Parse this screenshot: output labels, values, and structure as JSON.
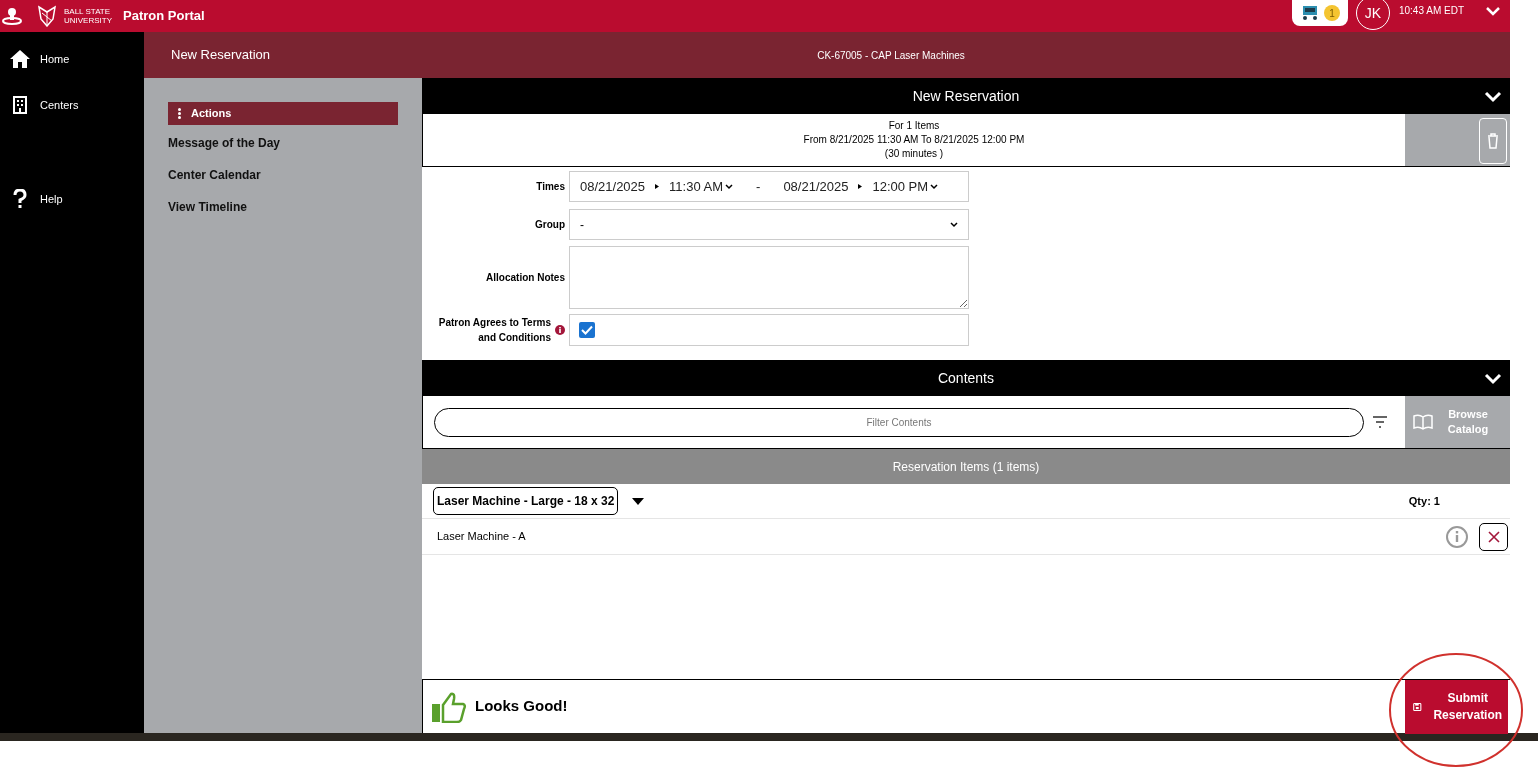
{
  "top_bar": {
    "university": "BALL STATE UNIVERSITY",
    "title": "Patron Portal",
    "cart_count": "1",
    "user_initials": "JK",
    "time": "10:43 AM EDT"
  },
  "nav": [
    {
      "kind": "home",
      "label": "Home"
    },
    {
      "kind": "building",
      "label": "Centers"
    },
    {
      "kind": "help",
      "label": "Help"
    }
  ],
  "page_header": {
    "title": "New Reservation",
    "center": "CK-67005 - CAP Laser Machines"
  },
  "actions": {
    "title": "Actions",
    "items": [
      "Message of the Day",
      "Center Calendar",
      "View Timeline"
    ]
  },
  "reservation": {
    "title": "New Reservation",
    "summary": [
      "For 1 Items",
      "From 8/21/2025 11:30 AM To 8/21/2025 12:00 PM",
      "(30 minutes )"
    ],
    "times": {
      "label": "Times",
      "start_date": "08/21/2025",
      "start_time": "11:30 AM",
      "separator": "-",
      "end_date": "08/21/2025",
      "end_time": "12:00 PM"
    },
    "group": {
      "label": "Group",
      "value": "-"
    },
    "notes": {
      "label": "Allocation Notes"
    },
    "terms": {
      "label": "Patron Agrees to Terms and Conditions",
      "checked": true
    }
  },
  "contents": {
    "title": "Contents",
    "filter_placeholder": "Filter Contents",
    "browse": "Browse Catalog",
    "items_header": "Reservation Items (1 items)",
    "groups": [
      {
        "name": "Laser Machine - Large - 18 x 32",
        "qty": "Qty: 1",
        "items": [
          "Laser Machine - A"
        ]
      }
    ]
  },
  "footer": {
    "status": "Looks Good!",
    "submit": "Submit Reservation"
  }
}
